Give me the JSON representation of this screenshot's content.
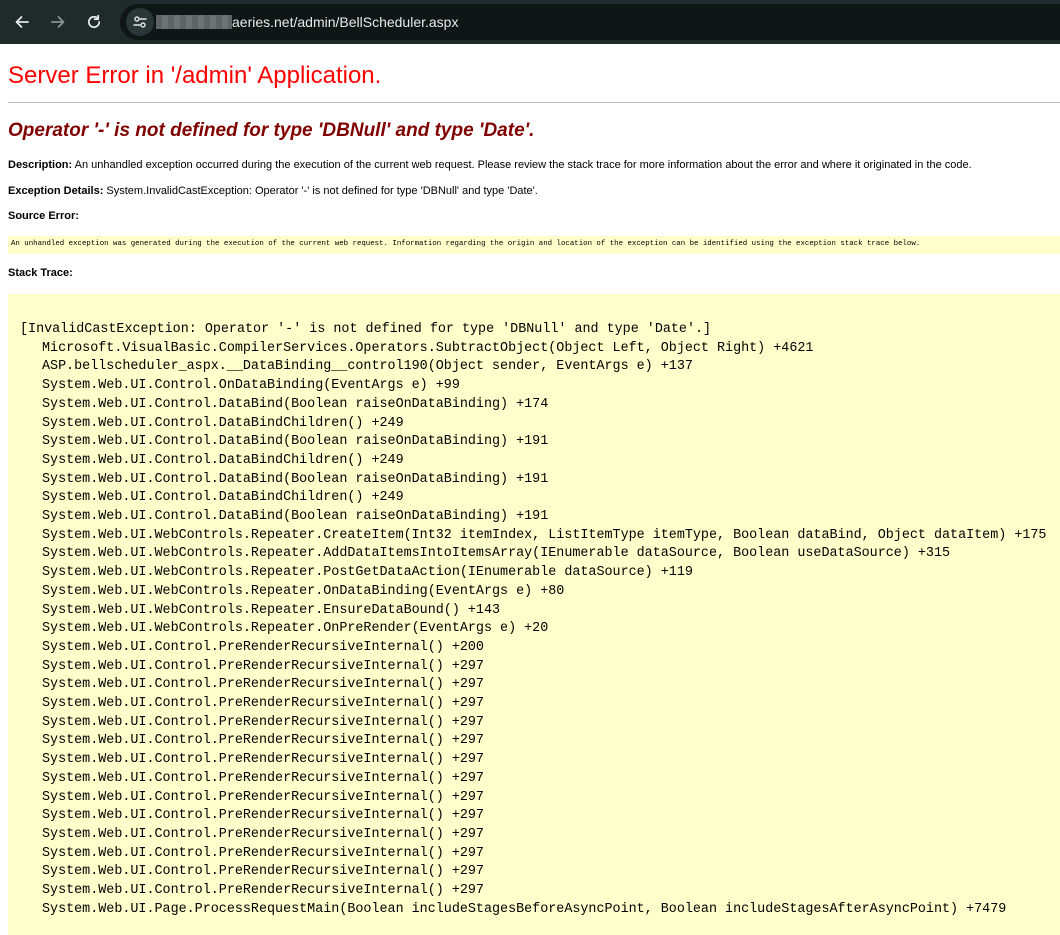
{
  "browser": {
    "url_domain": "aeries.net/admin/BellScheduler.aspx",
    "colors": {
      "toolbar": "#1f2a2a",
      "omnibox": "#0f1616"
    }
  },
  "error_page": {
    "title": "Server Error in '/admin' Application.",
    "message": "Operator '-' is not defined for type 'DBNull' and type 'Date'.",
    "description_label": "Description:",
    "description_text": " An unhandled exception occurred during the execution of the current web request. Please review the stack trace for more information about the error and where it originated in the code.",
    "exception_label": "Exception Details:",
    "exception_text": " System.InvalidCastException: Operator '-' is not defined for type 'DBNull' and type 'Date'.",
    "source_error_label": "Source Error:",
    "source_error_text": "An unhandled exception was generated during the execution of the current web request. Information regarding the origin and location of the exception can be identified using the exception stack trace below.",
    "stack_trace_label": "Stack Trace:",
    "stack_trace": [
      "[InvalidCastException: Operator '-' is not defined for type 'DBNull' and type 'Date'.]",
      "Microsoft.VisualBasic.CompilerServices.Operators.SubtractObject(Object Left, Object Right) +4621",
      "ASP.bellscheduler_aspx.__DataBinding__control190(Object sender, EventArgs e) +137",
      "System.Web.UI.Control.OnDataBinding(EventArgs e) +99",
      "System.Web.UI.Control.DataBind(Boolean raiseOnDataBinding) +174",
      "System.Web.UI.Control.DataBindChildren() +249",
      "System.Web.UI.Control.DataBind(Boolean raiseOnDataBinding) +191",
      "System.Web.UI.Control.DataBindChildren() +249",
      "System.Web.UI.Control.DataBind(Boolean raiseOnDataBinding) +191",
      "System.Web.UI.Control.DataBindChildren() +249",
      "System.Web.UI.Control.DataBind(Boolean raiseOnDataBinding) +191",
      "System.Web.UI.WebControls.Repeater.CreateItem(Int32 itemIndex, ListItemType itemType, Boolean dataBind, Object dataItem) +175",
      "System.Web.UI.WebControls.Repeater.AddDataItemsIntoItemsArray(IEnumerable dataSource, Boolean useDataSource) +315",
      "System.Web.UI.WebControls.Repeater.PostGetDataAction(IEnumerable dataSource) +119",
      "System.Web.UI.WebControls.Repeater.OnDataBinding(EventArgs e) +80",
      "System.Web.UI.WebControls.Repeater.EnsureDataBound() +143",
      "System.Web.UI.WebControls.Repeater.OnPreRender(EventArgs e) +20",
      "System.Web.UI.Control.PreRenderRecursiveInternal() +200",
      "System.Web.UI.Control.PreRenderRecursiveInternal() +297",
      "System.Web.UI.Control.PreRenderRecursiveInternal() +297",
      "System.Web.UI.Control.PreRenderRecursiveInternal() +297",
      "System.Web.UI.Control.PreRenderRecursiveInternal() +297",
      "System.Web.UI.Control.PreRenderRecursiveInternal() +297",
      "System.Web.UI.Control.PreRenderRecursiveInternal() +297",
      "System.Web.UI.Control.PreRenderRecursiveInternal() +297",
      "System.Web.UI.Control.PreRenderRecursiveInternal() +297",
      "System.Web.UI.Control.PreRenderRecursiveInternal() +297",
      "System.Web.UI.Control.PreRenderRecursiveInternal() +297",
      "System.Web.UI.Control.PreRenderRecursiveInternal() +297",
      "System.Web.UI.Control.PreRenderRecursiveInternal() +297",
      "System.Web.UI.Control.PreRenderRecursiveInternal() +297",
      "System.Web.UI.Page.ProcessRequestMain(Boolean includeStagesBeforeAsyncPoint, Boolean includeStagesAfterAsyncPoint) +7479"
    ],
    "colors": {
      "title": "#ff0000",
      "message": "#800000",
      "highlight_bg": "#ffffcc",
      "rule": "#c0c0c0"
    }
  }
}
